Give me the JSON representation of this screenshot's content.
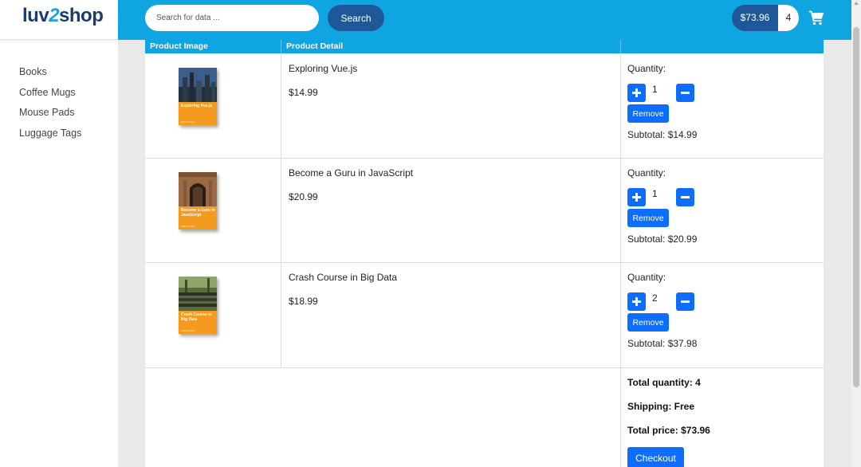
{
  "brand": {
    "logo_prefix": "luv",
    "logo_two": "2",
    "logo_suffix": "shop"
  },
  "sidebar": {
    "items": [
      {
        "label": "Books"
      },
      {
        "label": "Coffee Mugs"
      },
      {
        "label": "Mouse Pads"
      },
      {
        "label": "Luggage Tags"
      }
    ]
  },
  "header": {
    "search_placeholder": "Search for data ...",
    "search_button": "Search",
    "cart_total": "$73.96",
    "cart_count": "4",
    "cart_icon": "shopping-cart-icon"
  },
  "table": {
    "col_image": "Product Image",
    "col_detail": "Product Detail"
  },
  "items": [
    {
      "name": "Exploring Vue.js",
      "price": "$14.99",
      "quantity_label": "Quantity:",
      "quantity": "1",
      "remove_label": "Remove",
      "subtotal": "Subtotal: $14.99",
      "cover_title": "Exploring Vue.js",
      "cover_author": "Author Name"
    },
    {
      "name": "Become a Guru in JavaScript",
      "price": "$20.99",
      "quantity_label": "Quantity:",
      "quantity": "1",
      "remove_label": "Remove",
      "subtotal": "Subtotal: $20.99",
      "cover_title": "Become a Guru in JavaScript",
      "cover_author": "Author Name"
    },
    {
      "name": "Crash Course in Big Data",
      "price": "$18.99",
      "quantity_label": "Quantity:",
      "quantity": "2",
      "remove_label": "Remove",
      "subtotal": "Subtotal: $37.98",
      "cover_title": "Crash Course in Big Data",
      "cover_author": "Author Name"
    }
  ],
  "summary": {
    "total_quantity": "Total quantity: 4",
    "shipping": "Shipping: Free",
    "total_price": "Total price: $73.96",
    "checkout_label": "Checkout"
  },
  "colors": {
    "header": "#0ea5e1",
    "dark_button": "#1e5899",
    "primary_button": "#0d6efd",
    "book_cover": "#f39a1f"
  }
}
